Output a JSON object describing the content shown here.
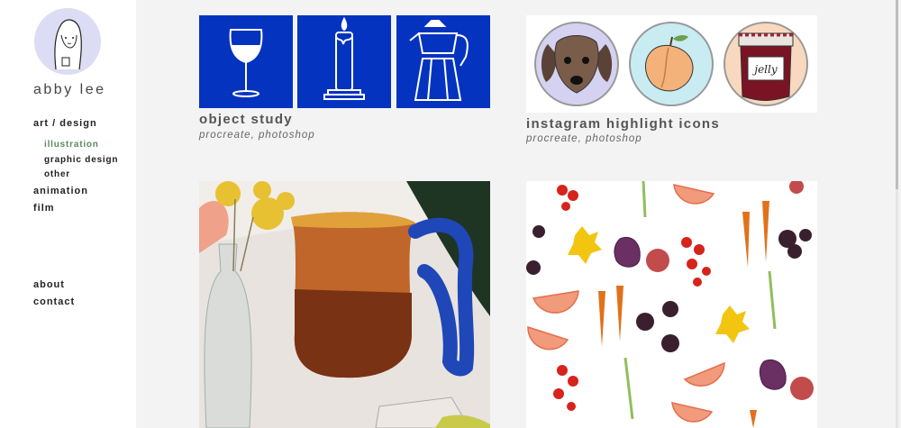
{
  "site": {
    "name": "abby lee"
  },
  "nav": {
    "art_design": "art / design",
    "illustration": "illustration",
    "graphic_design": "graphic design",
    "other": "other",
    "animation": "animation",
    "film": "film",
    "about": "about",
    "contact": "contact"
  },
  "projects": [
    {
      "title": "object study",
      "tools": "procreate, photoshop",
      "icons": [
        "wine-glass-icon",
        "candle-icon",
        "moka-pot-icon"
      ]
    },
    {
      "title": "instagram highlight icons",
      "tools": "procreate, photoshop",
      "icons": [
        "dog-icon",
        "peach-icon",
        "jelly-jar-icon"
      ],
      "jar_label": "jelly"
    },
    {
      "title": "",
      "tools": ""
    },
    {
      "title": "",
      "tools": ""
    }
  ],
  "colors": {
    "accent": "#5a8a5e",
    "tile_blue": "#0433bf",
    "sidebar_bg": "#ffffff",
    "main_bg": "#f3f3f3"
  }
}
